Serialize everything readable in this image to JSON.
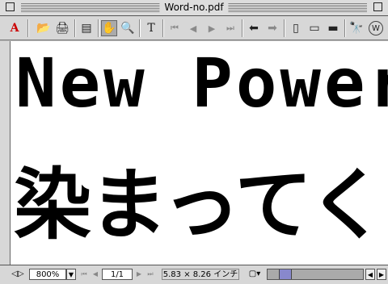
{
  "window": {
    "title": "Word-no.pdf"
  },
  "toolbar": {
    "icons": {
      "acrobat": "A",
      "open": "📂",
      "print": "🖨",
      "thumbnails": "▤",
      "hand": "✋",
      "zoom": "🔍",
      "text_select": "T",
      "first_page": "⏮",
      "prev_page": "◀",
      "next_page": "▶",
      "last_page": "⏭",
      "go_back": "⬅",
      "go_forward": "➡",
      "actual_size": "▯",
      "fit_page": "▭",
      "fit_width": "▬",
      "find": "🔭",
      "web": "W"
    }
  },
  "document": {
    "line1": "New Power",
    "line2": "染まってく"
  },
  "statusbar": {
    "zoom": "800%",
    "page": "1/1",
    "page_size": "5.83 × 8.26 インチ"
  }
}
